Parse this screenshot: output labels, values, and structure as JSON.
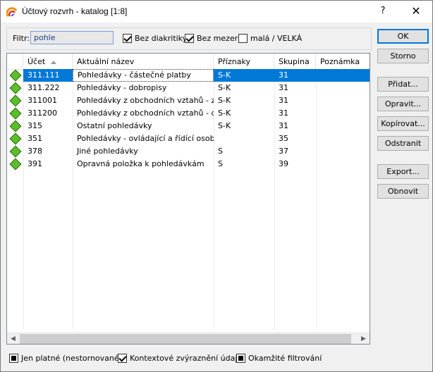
{
  "window": {
    "title": "Účtový rozvrh - katalog  [1:8]",
    "help_label": "?",
    "close_label": "✕"
  },
  "filter": {
    "label": "Filtr:",
    "value": "pohle",
    "checkboxes": [
      {
        "label": "Bez diakritiky",
        "checked": true
      },
      {
        "label": "Bez mezer",
        "checked": true
      },
      {
        "label": "malá / VELKÁ",
        "checked": false
      }
    ]
  },
  "buttons": {
    "ok": "OK",
    "storno": "Storno",
    "pridat": "Přidat...",
    "opravit": "Opravit...",
    "kopirovat": "Kopírovat...",
    "odstranit": "Odstranit",
    "export": "Export...",
    "obnovit": "Obnovit"
  },
  "table": {
    "columns": [
      "Účet",
      "Aktuální název",
      "Příznaky",
      "Skupina",
      "Poznámka"
    ],
    "selected_index": 0,
    "rows": [
      {
        "ucet": "311.111",
        "nazev": "Pohledávky - částečné platby",
        "priznaky": "S-K",
        "skupina": "31",
        "poznamka": ""
      },
      {
        "ucet": "311.222",
        "nazev": "Pohledávky - dobropisy",
        "priznaky": "S-K",
        "skupina": "31",
        "poznamka": ""
      },
      {
        "ucet": "311001",
        "nazev": "Pohledávky z obchodních vztahů - z...",
        "priznaky": "S-K",
        "skupina": "31",
        "poznamka": ""
      },
      {
        "ucet": "311200",
        "nazev": "Pohledávky z obchodních vztahů - dl...",
        "priznaky": "S-K",
        "skupina": "31",
        "poznamka": ""
      },
      {
        "ucet": "315",
        "nazev": "Ostatní pohledávky",
        "priznaky": "S-K",
        "skupina": "31",
        "poznamka": ""
      },
      {
        "ucet": "351",
        "nazev": "Pohledávky - ovládající a řídící osoba",
        "priznaky": "",
        "skupina": "35",
        "poznamka": ""
      },
      {
        "ucet": "378",
        "nazev": "Jiné pohledávky",
        "priznaky": "S",
        "skupina": "37",
        "poznamka": ""
      },
      {
        "ucet": "391",
        "nazev": "Opravná položka k pohledávkám",
        "priznaky": "S",
        "skupina": "39",
        "poznamka": ""
      }
    ]
  },
  "bottom": {
    "checkboxes": [
      {
        "label": "Jen platné (nestornované)",
        "state": "filled"
      },
      {
        "label": "Kontextové zvýraznění údajů",
        "state": "checked"
      },
      {
        "label": "Okamžité filtrování",
        "state": "filled"
      }
    ]
  },
  "colors": {
    "selection": "#0078d7",
    "row_icon": "#5cbf2a",
    "accent_border": "#0078d7"
  },
  "icons": {
    "app": "app-logo-icon",
    "row": "green-diamond-icon"
  }
}
